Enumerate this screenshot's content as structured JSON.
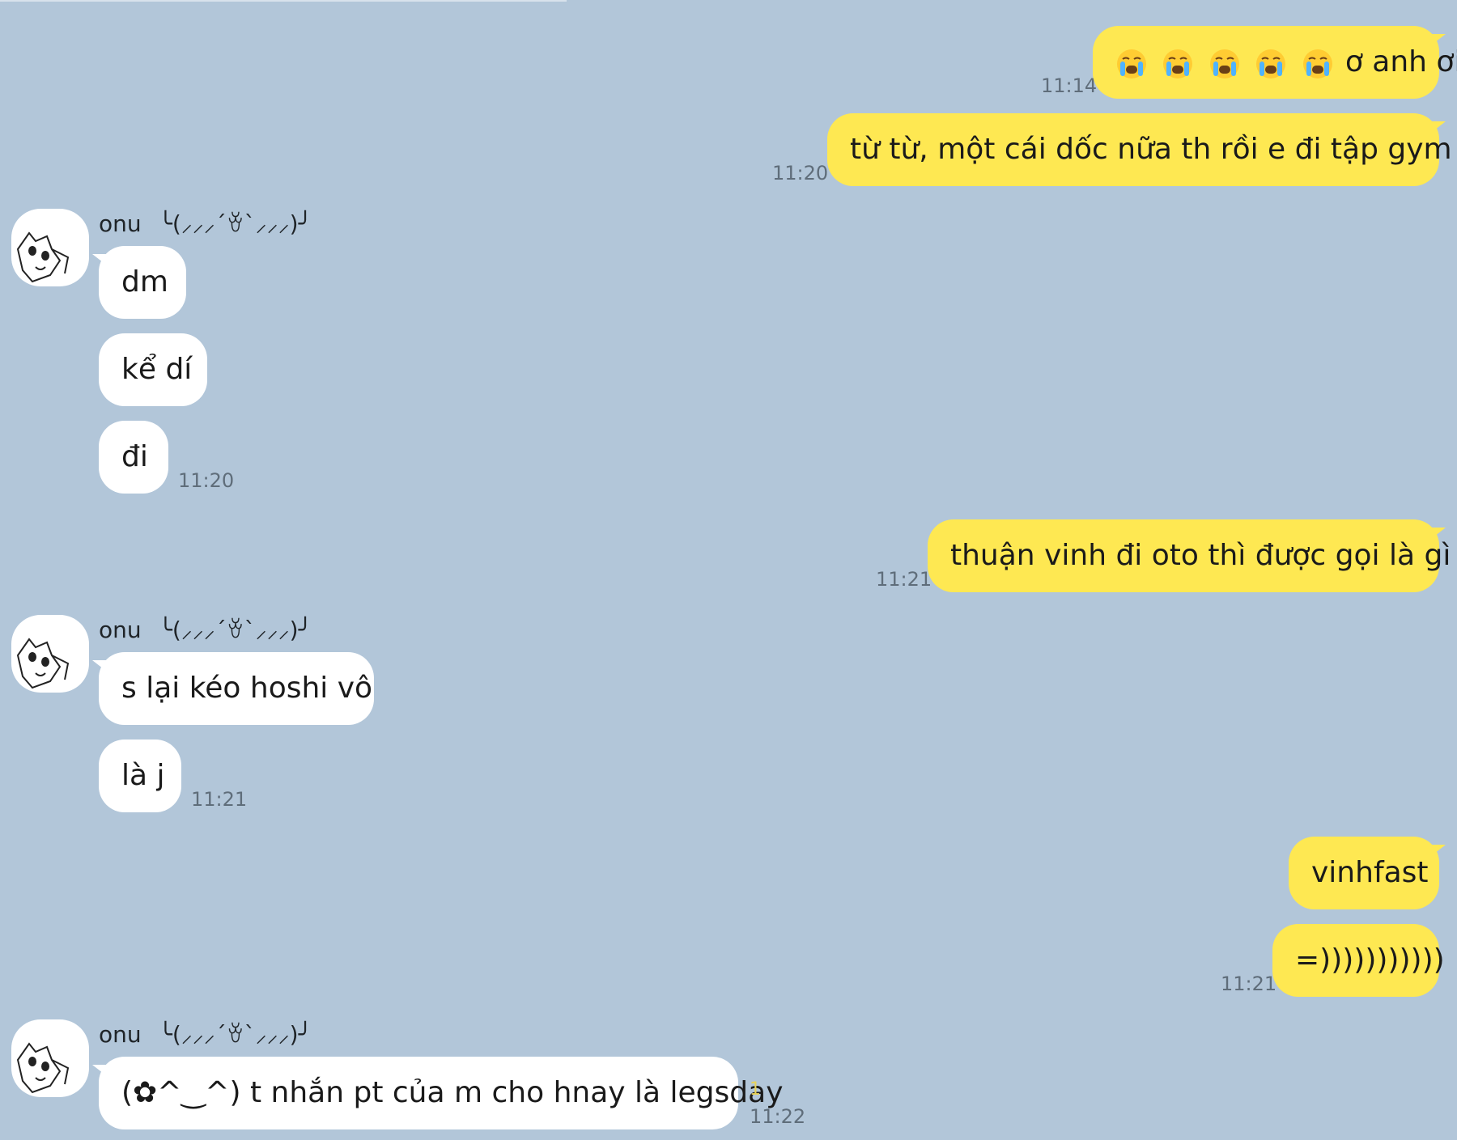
{
  "colors": {
    "background": "#b2c6d9",
    "outgoing_bubble": "#fee852",
    "incoming_bubble": "#ffffff",
    "timestamp": "#5f6d7a",
    "unread": "#e7d35a"
  },
  "contact": {
    "name": "onu",
    "kaomoji": "╰(⸝⸝⸝´ꈊ`⸝⸝⸝)╯",
    "avatar_icon": "cat-sketch-avatar"
  },
  "messages": [
    {
      "direction": "out",
      "text": "ơ anh ơi",
      "emoji": "loudly-crying-face",
      "emoji_count": 5,
      "time": "11:14"
    },
    {
      "direction": "out",
      "text": "từ từ, một cái dốc nữa th rồi e đi tập gym",
      "time": "11:20"
    },
    {
      "direction": "in",
      "text": "dm"
    },
    {
      "direction": "in",
      "text": "kể dí"
    },
    {
      "direction": "in",
      "text": "đi",
      "time": "11:20"
    },
    {
      "direction": "out",
      "text": "thuận vinh đi oto thì được gọi là gì",
      "time": "11:21"
    },
    {
      "direction": "in",
      "text": "s lại kéo hoshi vô"
    },
    {
      "direction": "in",
      "text": "là j",
      "time": "11:21"
    },
    {
      "direction": "out",
      "text": "vinhfast"
    },
    {
      "direction": "out",
      "text": "=)))))))))))",
      "time": "11:21"
    },
    {
      "direction": "in",
      "text": "(✿^‿^) t nhắn pt của m cho hnay là legsday",
      "time": "11:22",
      "unread": "1"
    }
  ]
}
